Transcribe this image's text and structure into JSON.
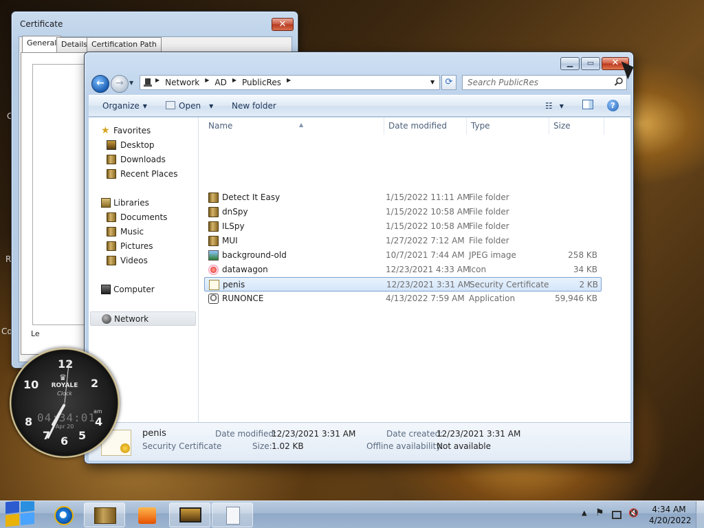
{
  "certificate": {
    "title": "Certificate",
    "tabs": [
      "General",
      "Details",
      "Certification Path"
    ],
    "clipped_label": "Le"
  },
  "explorer": {
    "breadcrumbs": [
      "Network",
      "AD",
      "PublicRes"
    ],
    "search_placeholder": "Search PublicRes",
    "toolbar": {
      "organize": "Organize",
      "open": "Open",
      "new_folder": "New folder"
    },
    "nav": {
      "favorites": "Favorites",
      "desktop": "Desktop",
      "downloads": "Downloads",
      "recent": "Recent Places",
      "libraries": "Libraries",
      "documents": "Documents",
      "music": "Music",
      "pictures": "Pictures",
      "videos": "Videos",
      "computer": "Computer",
      "network": "Network"
    },
    "columns": {
      "name": "Name",
      "date": "Date modified",
      "type": "Type",
      "size": "Size"
    },
    "files": [
      {
        "name": "Detect It Easy",
        "date": "1/15/2022 11:11 AM",
        "type": "File folder",
        "size": "",
        "icon": "folder-icon"
      },
      {
        "name": "dnSpy",
        "date": "1/15/2022 10:58 AM",
        "type": "File folder",
        "size": "",
        "icon": "folder-icon"
      },
      {
        "name": "ILSpy",
        "date": "1/15/2022 10:58 AM",
        "type": "File folder",
        "size": "",
        "icon": "folder-icon"
      },
      {
        "name": "MUI",
        "date": "1/27/2022 7:12 AM",
        "type": "File folder",
        "size": "",
        "icon": "folder-icon"
      },
      {
        "name": "background-old",
        "date": "10/7/2021 7:44 AM",
        "type": "JPEG image",
        "size": "258 KB",
        "icon": "image-icon"
      },
      {
        "name": "datawagon",
        "date": "12/23/2021 4:33 AM",
        "type": "Icon",
        "size": "34 KB",
        "icon": "icon-file-icon"
      },
      {
        "name": "penis",
        "date": "12/23/2021 3:31 AM",
        "type": "Security Certificate",
        "size": "2 KB",
        "icon": "certificate-icon"
      },
      {
        "name": "RUNONCE",
        "date": "4/13/2022 7:59 AM",
        "type": "Application",
        "size": "59,946 KB",
        "icon": "application-icon"
      }
    ],
    "details": {
      "name": "penis",
      "type": "Security Certificate",
      "modified_label": "Date modified:",
      "modified_value": "12/23/2021 3:31 AM",
      "size_label": "Size:",
      "size_value": "1.02 KB",
      "created_label": "Date created:",
      "created_value": "12/23/2021 3:31 AM",
      "offline_label": "Offline availability:",
      "offline_value": "Not available"
    }
  },
  "clock_gadget": {
    "brand": "ROYALE",
    "sub": "Clock",
    "digital": "04:34:01",
    "date": "Apr 20",
    "am": "am",
    "numerals": [
      "12",
      "2",
      "4",
      "5",
      "6",
      "7",
      "8",
      "10"
    ]
  },
  "taskbar": {
    "time": "4:34 AM",
    "date": "4/20/2022"
  },
  "desktop_edge": [
    "C",
    "R",
    "Co"
  ]
}
